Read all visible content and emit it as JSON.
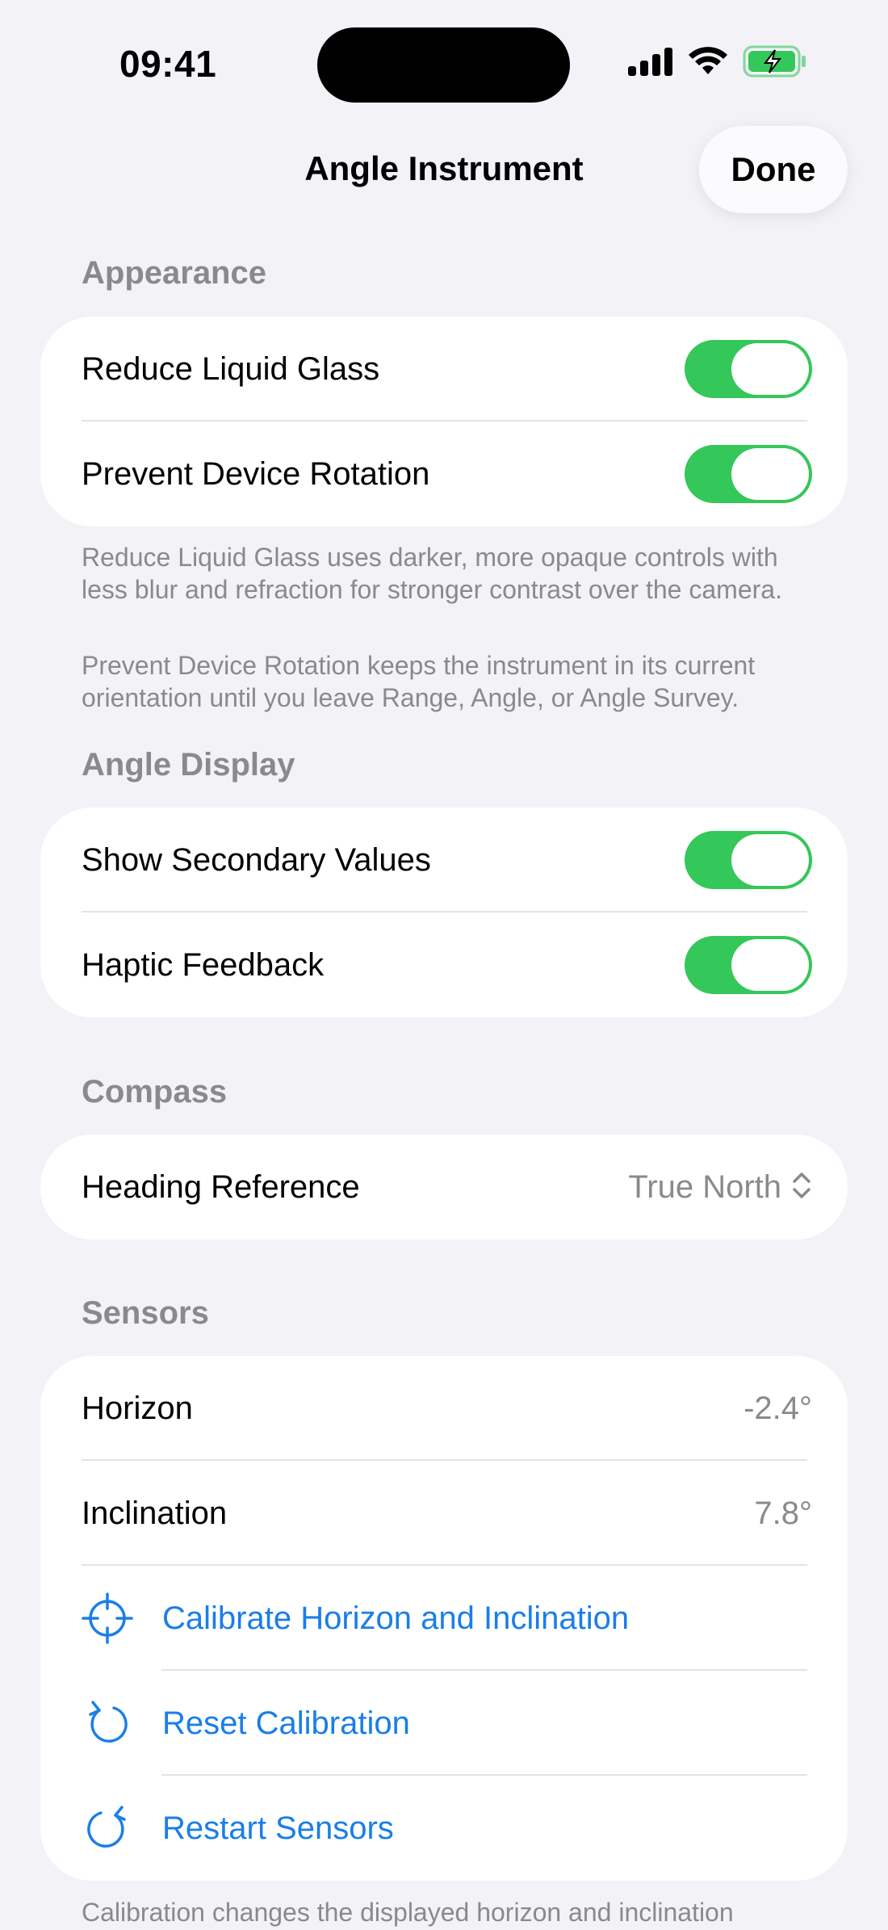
{
  "status_bar": {
    "time": "09:41"
  },
  "nav": {
    "title": "Angle Instrument",
    "done_label": "Done"
  },
  "appearance": {
    "header": "Appearance",
    "rows": [
      {
        "label": "Reduce Liquid Glass",
        "on": true
      },
      {
        "label": "Prevent Device Rotation",
        "on": true
      }
    ],
    "footnotes": [
      "Reduce Liquid Glass uses darker, more opaque controls with less blur and refraction for stronger contrast over the camera.",
      "Prevent Device Rotation keeps the instrument in its current orientation until you leave Range, Angle, or Angle Survey."
    ]
  },
  "angle_display": {
    "header": "Angle Display",
    "rows": [
      {
        "label": "Show Secondary Values",
        "on": true
      },
      {
        "label": "Haptic Feedback",
        "on": true
      }
    ]
  },
  "compass": {
    "header": "Compass",
    "heading_reference": {
      "label": "Heading Reference",
      "value": "True North"
    }
  },
  "sensors": {
    "header": "Sensors",
    "horizon": {
      "label": "Horizon",
      "value": "-2.4°"
    },
    "inclination": {
      "label": "Inclination",
      "value": "7.8°"
    },
    "actions": [
      {
        "label": "Calibrate Horizon and Inclination",
        "icon": "crosshair-icon"
      },
      {
        "label": "Reset Calibration",
        "icon": "counterclockwise-arrow-icon"
      },
      {
        "label": "Restart Sensors",
        "icon": "clockwise-arrow-icon"
      }
    ],
    "footnote": "Calibration changes the displayed horizon and inclination"
  },
  "colors": {
    "accent": "#1a7ee8",
    "toggle_on": "#34c759",
    "battery": "#34c759"
  }
}
